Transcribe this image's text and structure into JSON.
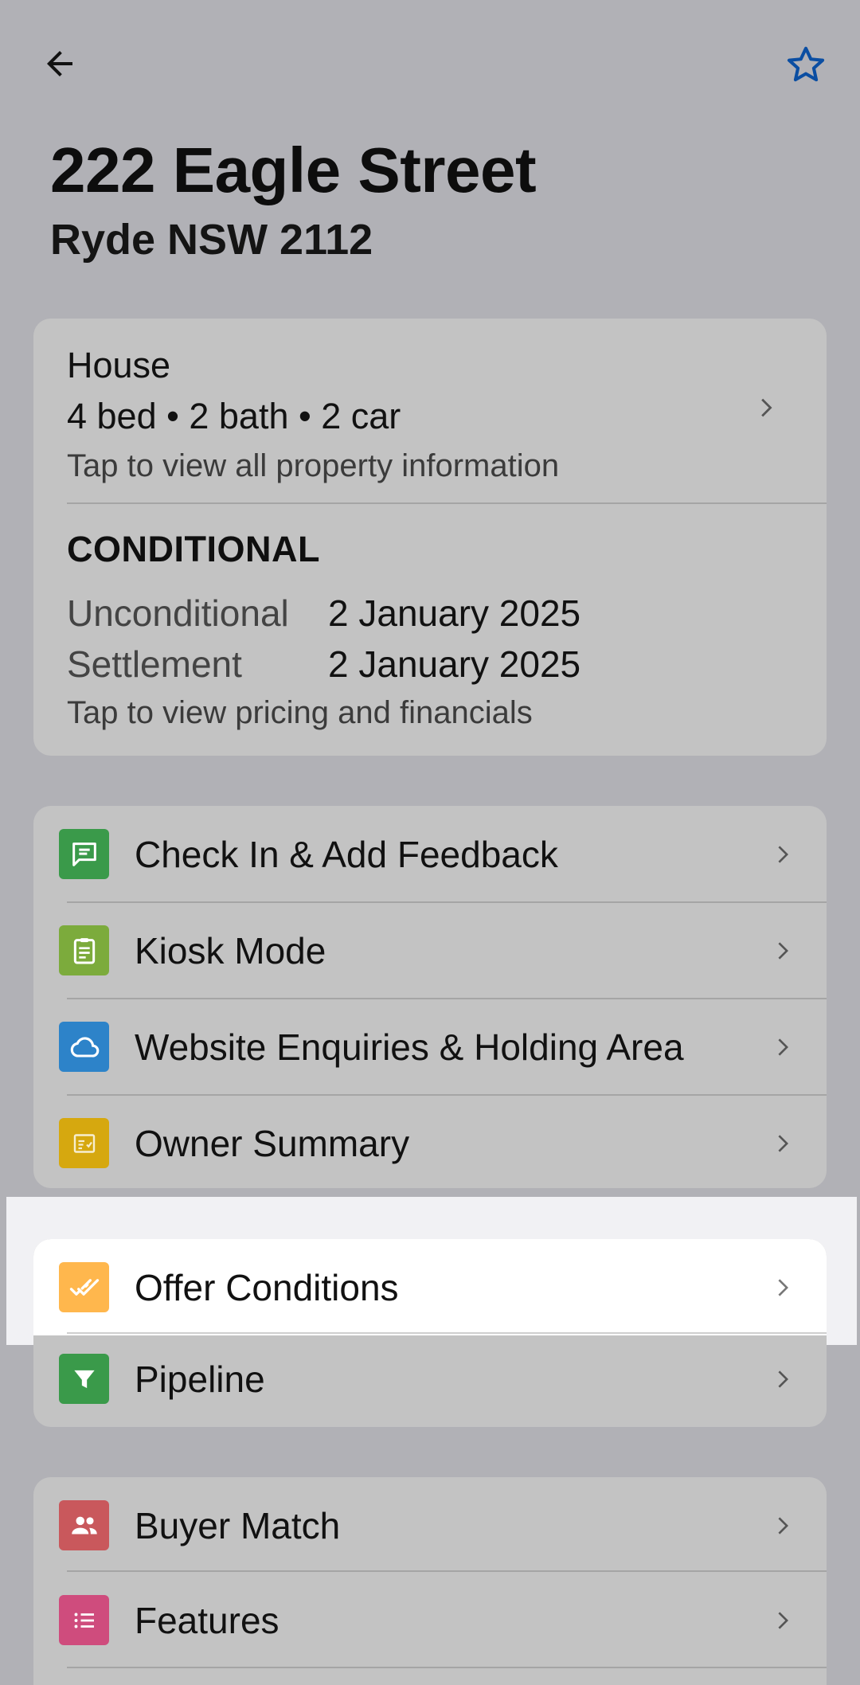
{
  "header": {
    "title": "222 Eagle Street",
    "subtitle": "Ryde NSW 2112",
    "back_icon": "arrow-left-icon",
    "favorite_icon": "star-outline-icon",
    "accent_color": "#0b4ea2"
  },
  "property": {
    "type": "House",
    "specs": "4 bed • 2 bath • 2 car",
    "hint": "Tap to view all property information"
  },
  "status": {
    "title": "CONDITIONAL",
    "unconditional_label": "Unconditional",
    "unconditional_date": "2 January 2025",
    "settlement_label": "Settlement",
    "settlement_date": "2 January 2025",
    "hint": "Tap to view pricing and financials"
  },
  "menu_group1": [
    {
      "label": "Check In & Add Feedback",
      "icon": "feedback-icon",
      "color": "#3a9a4a"
    },
    {
      "label": "Kiosk Mode",
      "icon": "clipboard-icon",
      "color": "#7cab3c"
    },
    {
      "label": "Website Enquiries & Holding Area",
      "icon": "cloud-icon",
      "color": "#2d83c9"
    },
    {
      "label": "Owner Summary",
      "icon": "summary-icon",
      "color": "#d6a80f"
    }
  ],
  "menu_group2": [
    {
      "label": "Offer Conditions",
      "icon": "double-check-icon",
      "color": "#ffb74d"
    },
    {
      "label": "Pipeline",
      "icon": "funnel-icon",
      "color": "#3a9a4a"
    }
  ],
  "menu_group3": [
    {
      "label": "Buyer Match",
      "icon": "people-icon",
      "color": "#c9585c"
    },
    {
      "label": "Features",
      "icon": "list-icon",
      "color": "#cf4c7d"
    }
  ]
}
